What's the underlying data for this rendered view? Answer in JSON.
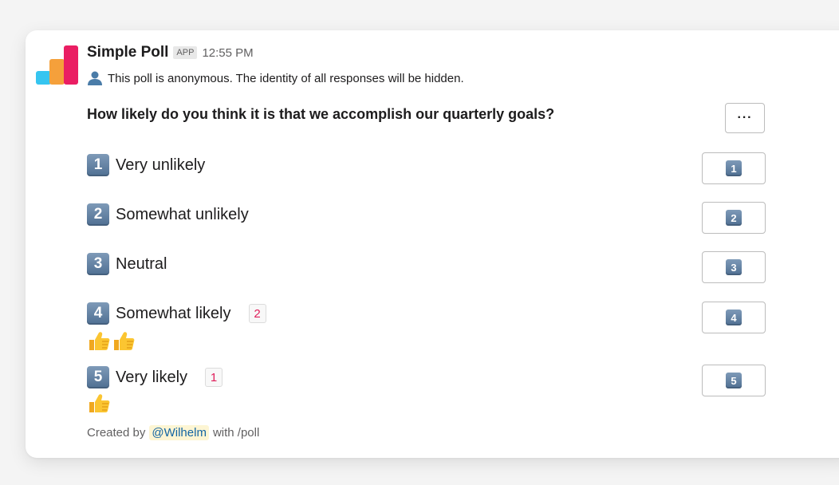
{
  "header": {
    "app_name": "Simple Poll",
    "app_badge": "APP",
    "time": "12:55 PM"
  },
  "anonymous_notice": "This poll is anonymous. The identity of all responses will be hidden.",
  "question": "How likely do you think it is that we accomplish our quarterly goals?",
  "more_button": "···",
  "options": [
    {
      "number": "1",
      "label": "Very unlikely",
      "votes": ""
    },
    {
      "number": "2",
      "label": "Somewhat unlikely",
      "votes": ""
    },
    {
      "number": "3",
      "label": "Neutral",
      "votes": ""
    },
    {
      "number": "4",
      "label": "Somewhat likely",
      "votes": "2"
    },
    {
      "number": "5",
      "label": "Very likely",
      "votes": "1"
    }
  ],
  "footer": {
    "prefix": "Created by",
    "mention": "@Wilhelm",
    "suffix": "with /poll"
  },
  "icons": {
    "logo": "simple-poll-logo",
    "anon": "person-icon",
    "reaction": "thumbs-up-icon"
  },
  "colors": {
    "logo_blue": "#36c5f0",
    "logo_orange": "#f5a03b",
    "logo_pink": "#ea1e63",
    "vote_count": "#e01e5a",
    "mention": "#1264a3"
  }
}
